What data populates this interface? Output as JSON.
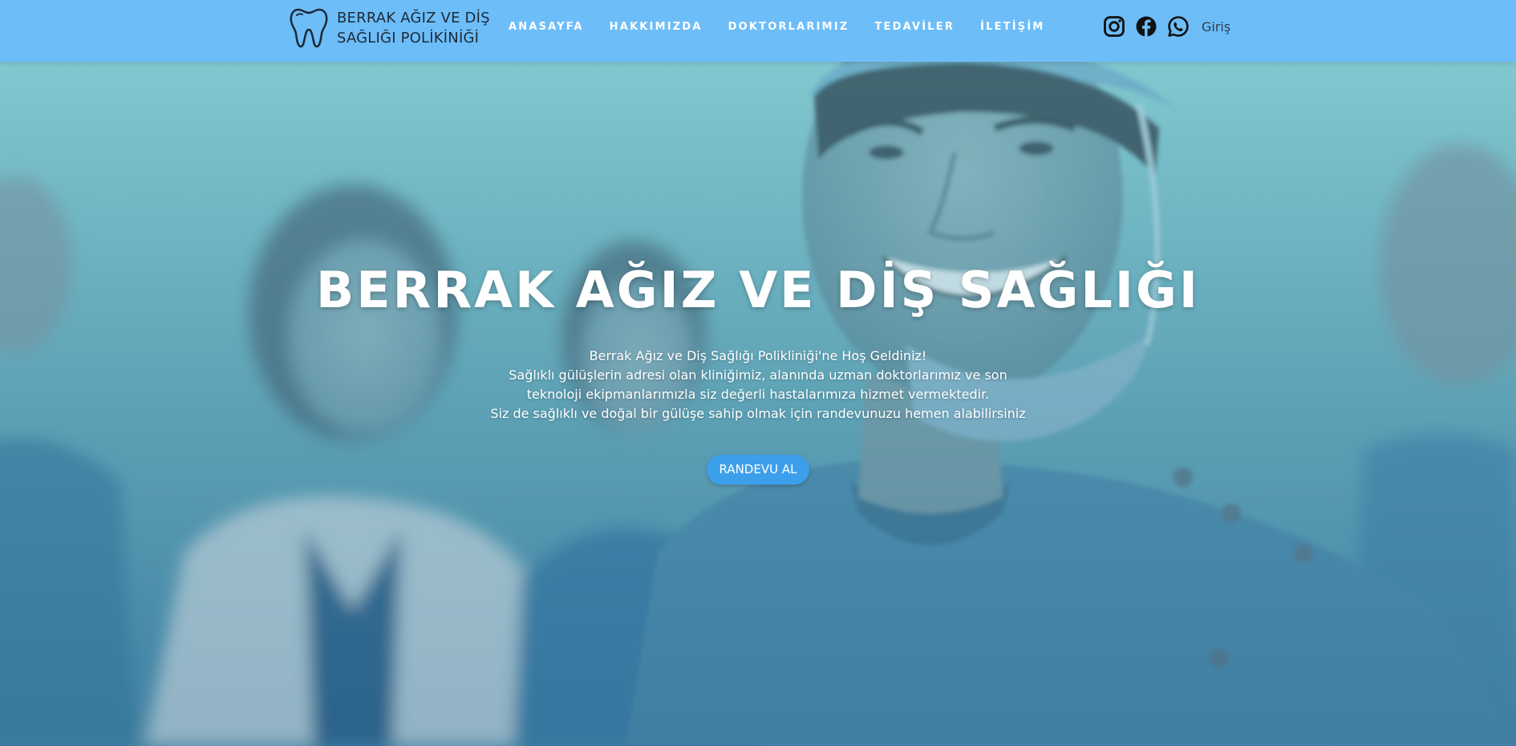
{
  "header": {
    "logo": {
      "icon": "tooth-icon",
      "line1": "BERRAK AĞIZ VE DİŞ",
      "line2": "SAĞLIĞI POLİKİNİĞİ"
    },
    "nav": [
      {
        "label": "ANASAYFA"
      },
      {
        "label": "HAKKIMIZDA"
      },
      {
        "label": "DOKTORLARIMIZ"
      },
      {
        "label": "TEDAVİLER"
      },
      {
        "label": "İLETİŞİM"
      }
    ],
    "socials": [
      {
        "icon": "instagram-icon"
      },
      {
        "icon": "facebook-icon"
      },
      {
        "icon": "whatsapp-icon"
      }
    ],
    "login_label": "Giriş"
  },
  "hero": {
    "title": "BERRAK AĞIZ VE DİŞ SAĞLIĞI",
    "lines": [
      "Berrak Ağız ve Diş Sağlığı Polikliniği'ne Hoş Geldiniz!",
      "Sağlıklı gülüşlerin adresi olan kliniğimiz, alanında uzman doktorlarımız ve son",
      "teknoloji ekipmanlarımızla siz değerli hastalarımıza hizmet vermektedir.",
      "Siz de sağlıklı ve doğal bir gülüşe sahip olmak için randevunuzu hemen alabilirsiniz"
    ],
    "cta_label": "RANDEVU AL"
  },
  "colors": {
    "header_bg": "#6dbdf9",
    "cta_bg": "#3c9fec",
    "hero_tint": "#5f9fb3"
  }
}
